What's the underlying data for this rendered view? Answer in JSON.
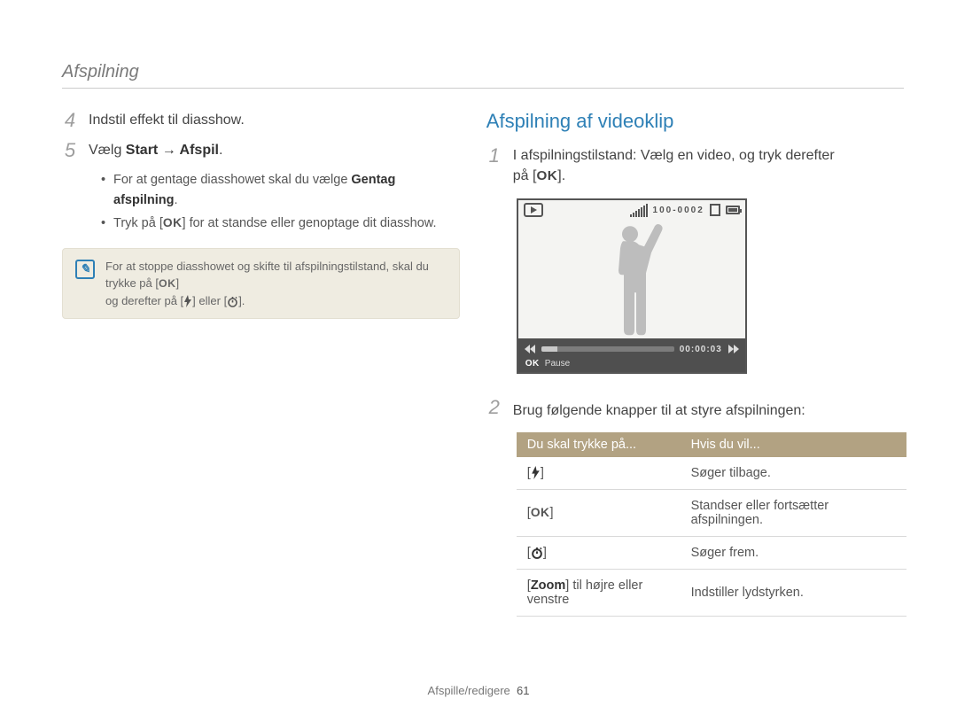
{
  "header": {
    "section": "Afspilning"
  },
  "left": {
    "step4_num": "4",
    "step4_text": "Indstil effekt til diasshow.",
    "step5_num": "5",
    "step5_pre": "Vælg ",
    "step5_bold": "Start → Afspil",
    "step5_post": ".",
    "bullets": [
      {
        "pre": "For at gentage diasshowet skal du vælge ",
        "bold": "Gentag afspilning",
        "post": "."
      },
      {
        "pre": "Tryk på [",
        "ok": "OK",
        "post": "] for at standse eller genoptage dit diasshow."
      }
    ],
    "note": {
      "line1_pre": "For at stoppe diasshowet og skifte til afspilningstilstand, skal du trykke på [",
      "line1_ok": "OK",
      "line1_post": "]",
      "line2_pre": "og derefter på [",
      "line2_mid": "] eller [",
      "line2_post": "]."
    }
  },
  "right": {
    "heading": "Afspilning af videoklip",
    "step1_num": "1",
    "step1_line1": "I afspilningstilstand: Vælg en video, og tryk derefter",
    "step1_line2_pre": "på [",
    "step1_ok": "OK",
    "step1_line2_post": "].",
    "thumb": {
      "top_right_code": "100-0002",
      "time": "00:00:03",
      "ok": "OK",
      "pause": "Pause"
    },
    "step2_num": "2",
    "step2_text": "Brug følgende knapper til at styre afspilningen:",
    "table": {
      "h1": "Du skal trykke på...",
      "h2": "Hvis du vil...",
      "rows": [
        {
          "key_type": "flash",
          "key_wrap_pre": "[",
          "key_wrap_post": "]",
          "action": "Søger tilbage."
        },
        {
          "key_type": "ok",
          "key_wrap_pre": "[",
          "key_text": "OK",
          "key_wrap_post": "]",
          "action": "Standser eller fortsætter afspilningen."
        },
        {
          "key_type": "timer",
          "key_wrap_pre": "[",
          "key_wrap_post": "]",
          "action": "Søger frem."
        },
        {
          "key_type": "text",
          "key_pre": "[",
          "key_bold": "Zoom",
          "key_post": "] til højre eller venstre",
          "action": "Indstiller lydstyrken."
        }
      ]
    }
  },
  "footer": {
    "label": "Afspille/redigere",
    "page": "61"
  }
}
